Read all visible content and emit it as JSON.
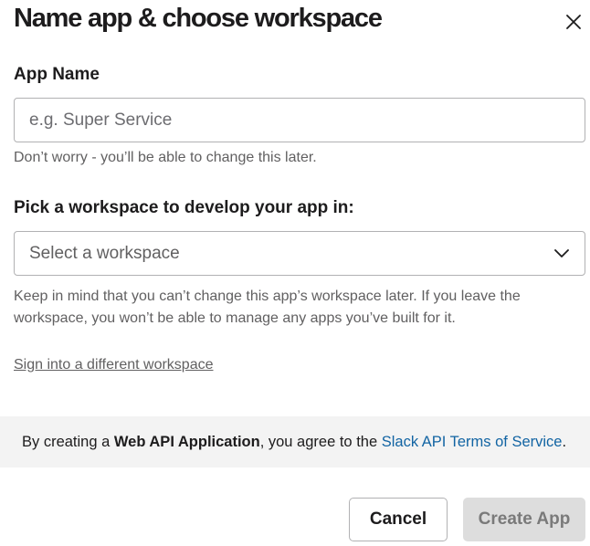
{
  "dialog": {
    "title": "Name app & choose workspace",
    "close_icon": "close-icon"
  },
  "app_name": {
    "label": "App Name",
    "value": "",
    "placeholder": "e.g. Super Service",
    "hint": "Don’t worry - you’ll be able to change this later."
  },
  "workspace": {
    "label": "Pick a workspace to develop your app in:",
    "selected": "Select a workspace",
    "dropdown_icon": "chevron-down-icon",
    "hint": "Keep in mind that you can’t change this app’s workspace later. If you leave the workspace, you won’t be able to manage any apps you’ve built for it.",
    "signin_link": "Sign into a different workspace"
  },
  "terms": {
    "prefix": "By creating a ",
    "app_type": "Web API Application",
    "middle": ", you agree to the ",
    "link": "Slack API Terms of Service",
    "suffix": "."
  },
  "footer": {
    "cancel_label": "Cancel",
    "create_label": "Create App"
  },
  "colors": {
    "link": "#1264a3",
    "text": "#1d1c1d",
    "muted": "#616061",
    "terms_bg": "#f3f3f3",
    "disabled_button_bg": "#dddddd"
  }
}
